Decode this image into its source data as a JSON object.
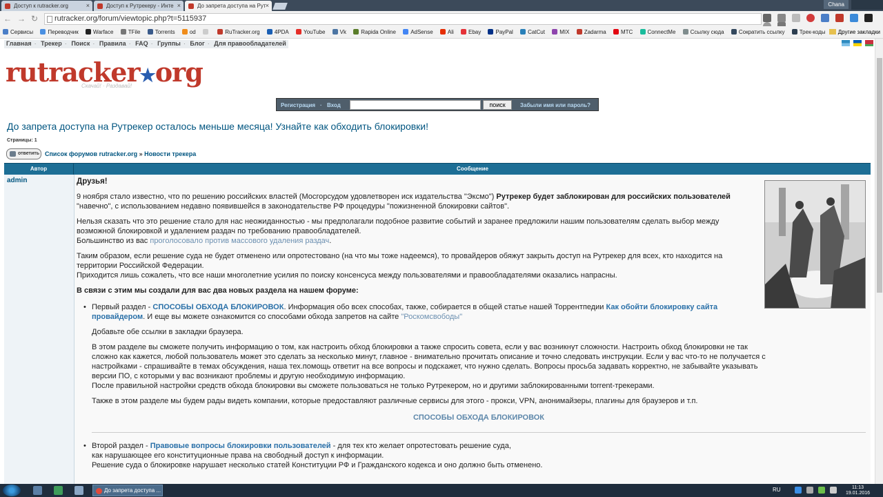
{
  "browser": {
    "tabs": [
      {
        "label": "Доступ к rutracker.org",
        "active": false
      },
      {
        "label": "Доступ к Рутрекеру - Инте",
        "active": false
      },
      {
        "label": "До запрета доступа на Рут",
        "active": true
      }
    ],
    "user_name": "Chana",
    "url": "rutracker.org/forum/viewtopic.php?t=5115937",
    "bookmarks": [
      {
        "label": "Сервисы",
        "color": "#4a7ec7"
      },
      {
        "label": "Переводчик",
        "color": "#4a90e2"
      },
      {
        "label": "Warface",
        "color": "#222222"
      },
      {
        "label": "TFile",
        "color": "#777777"
      },
      {
        "label": "Torrents",
        "color": "#3a5a8a"
      },
      {
        "label": "od",
        "color": "#f08c1a"
      },
      {
        "label": "",
        "color": "#cccccc"
      },
      {
        "label": "RuTracker.org",
        "color": "#c0392b"
      },
      {
        "label": "4PDA",
        "color": "#1a5fb4"
      },
      {
        "label": "YouTube",
        "color": "#e52d27"
      },
      {
        "label": "Vk",
        "color": "#4c75a3"
      },
      {
        "label": "Rapida Online",
        "color": "#5a7d2a"
      },
      {
        "label": "AdSense",
        "color": "#4285f4"
      },
      {
        "label": "Ali",
        "color": "#e62e04"
      },
      {
        "label": "Ebay",
        "color": "#e53238"
      },
      {
        "label": "PayPal",
        "color": "#003087"
      },
      {
        "label": "CatCut",
        "color": "#2980b9"
      },
      {
        "label": "MIX",
        "color": "#8e44ad"
      },
      {
        "label": "Zadarma",
        "color": "#c0392b"
      },
      {
        "label": "МТС",
        "color": "#e30611"
      },
      {
        "label": "ConnectMe",
        "color": "#1abc9c"
      },
      {
        "label": "Ссылку сюда",
        "color": "#7f8c8d"
      },
      {
        "label": "Сократить ссылку",
        "color": "#34495e"
      },
      {
        "label": "Трек-коды",
        "color": "#2c3e50"
      }
    ],
    "bookmarks_other": "Другие закладки"
  },
  "site": {
    "topnav": [
      "Главная",
      "Трекер",
      "Поиск",
      "Правила",
      "FAQ",
      "Группы",
      "Блог",
      "Для правообладателей"
    ],
    "logo_text": "rutracker",
    "logo_star": "★",
    "logo_suffix": "org",
    "logo_sub": "Скачай! · Раздавай!",
    "login": {
      "register": "Регистрация",
      "dot": "·",
      "login": "Вход",
      "search_button": "поиск",
      "forgot": "Забыли имя или пароль?"
    }
  },
  "topic": {
    "title": "До запрета доступа на Рутрекер осталось меньше месяца! Узнайте как обходить блокировки!",
    "pages_label": "Страницы:",
    "pages_value": "1",
    "reply_label": "ответить",
    "breadcrumb": [
      "Список форумов rutracker.org",
      "Новости трекера"
    ],
    "breadcrumb_sep": "»"
  },
  "post": {
    "col_author": "Автор",
    "col_message": "Сообщение",
    "author": "admin",
    "greeting": "Друзья!",
    "p1_a": "9 ноября стало известно, что по решению российских властей (Мосгорсудом удовлетворен иск издательства \"Эксмо\") ",
    "p1_b": "Рутрекер будет заблокирован для российских пользователей",
    "p1_c": " \"навечно\", с использованием недавно появившейся в законодательстве РФ процедуры \"пожизненной блокировки сайтов\".",
    "p2_a": "Нельзя сказать что это решение стало для нас неожиданностью - мы предполагали подобное развитие событий и заранее предложили нашим пользователям сделать выбор между возможной блокировкой и удалением раздач по требованию правообладателей.",
    "p2_b": "Большинство из вас ",
    "p2_link": "проголосовало против массового удаления раздач",
    "p2_c": ".",
    "p3_a": "Таким образом, если решение суда не будет отменено или опротестовано (на что мы тоже надеемся), то провайдеров обяжут закрыть доступ на Рутрекер для всех, кто находится на территории Российской Федерации.",
    "p3_b": "Приходится лишь сожалеть, что все наши многолетние усилия по поиску консенсуса между пользователями и правообладателями оказались напрасны.",
    "section_heading": "В связи с этим мы создали для вас два новых раздела на нашем форуме:",
    "item1_a": "Первый раздел - ",
    "item1_link": "СПОСОБЫ ОБХОДА БЛОКИРОВОК",
    "item1_b": ". Информация обо всех способах, также, собирается в общей статье нашей Торрентпедии ",
    "item1_link2": "Как обойти блокировку сайта провайдером",
    "item1_c": ". И еще вы можете ознакомится со способами обхода запретов на сайте ",
    "item1_link3": "\"Роскомсвободы\"",
    "bookmark_hint": "Добавьте обе ссылки в закладки браузера.",
    "p4_a": "В этом разделе вы сможете получить информацию о том, как настроить обход блокировки а также спросить совета, если у вас возникнут сложности. Настроить обход блокировки не так сложно как кажется, любой пользователь может это сделать за несколько минут, главное - внимательно прочитать описание и точно следовать инструкции. Если у вас что-то не получается с настройками - спрашивайте в темах обсуждения, наша тех.помощь ответит на все вопросы и подскажет, что нужно сделать. Вопросы просьба задавать корректно, не забывайте указывать версии ПО, с которыми у вас возникают проблемы и другую необходимую информацию.",
    "p4_b": "После правильной настройки средств обхода блокировки вы сможете пользоваться не только Рутрекером, но и другими заблокированными torrent-трекерами.",
    "p5": "Также в этом разделе мы будем рады видеть компании, которые предоставляют различные сервисы для этого - прокси, VPN, анонимайзеры, плагины для браузеров и т.п.",
    "center_link": "СПОСОБЫ ОБХОДА БЛОКИРОВОК",
    "item2_a": "Второй раздел - ",
    "item2_link": "Правовые вопросы блокировки пользователей",
    "item2_b": " - для тех кто желает опротестовать решение суда,",
    "item2_c": "как нарушающее его конституционные права на свободный доступ к информации.",
    "item2_d": "Решение суда о блокировке нарушает несколько статей Конституции РФ и Гражданского кодекса и оно должно быть отменено."
  },
  "taskbar": {
    "task_label": "До запрета доступа ...",
    "lang": "RU",
    "time": "11:13",
    "date": "19.01.2016"
  },
  "colors": {
    "header_bar": "#1d6e95",
    "link": "#005580",
    "logo_red": "#c0392b"
  }
}
